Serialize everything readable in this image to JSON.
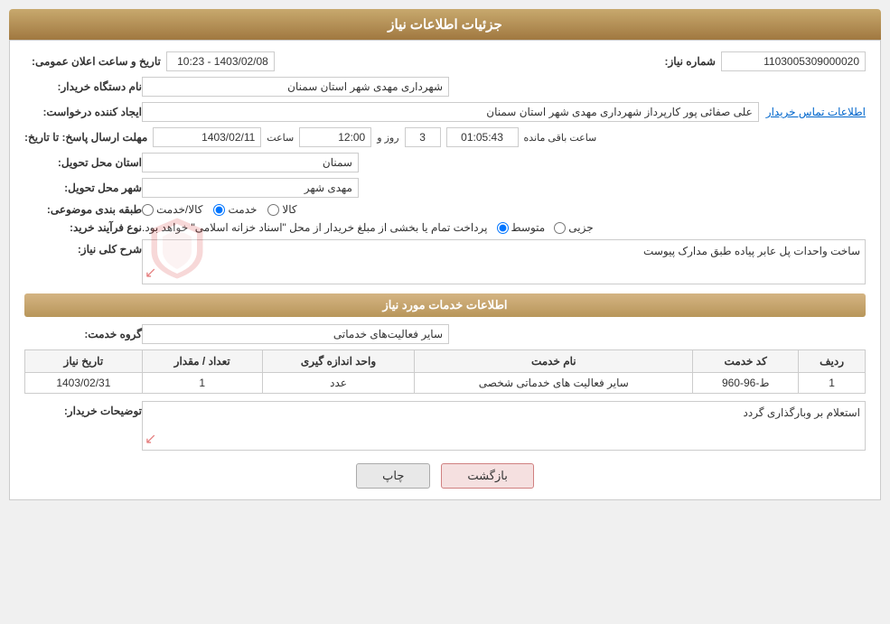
{
  "page": {
    "title": "جزئیات اطلاعات نیاز",
    "sections": {
      "basic_info": {
        "need_number_label": "شماره نیاز:",
        "need_number_value": "1103005309000020",
        "buyer_org_label": "نام دستگاه خریدار:",
        "buyer_org_value": "شهرداری مهدی شهر استان سمنان",
        "announce_date_label": "تاریخ و ساعت اعلان عمومی:",
        "announce_date_value": "1403/02/08 - 10:23",
        "creator_label": "ایجاد کننده درخواست:",
        "creator_value": "علی صفائی پور کارپرداز شهرداری مهدی شهر استان سمنان",
        "contact_link": "اطلاعات تماس خریدار",
        "deadline_label": "مهلت ارسال پاسخ: تا تاریخ:",
        "deadline_date": "1403/02/11",
        "deadline_time_label": "ساعت",
        "deadline_time": "12:00",
        "deadline_days_label": "روز و",
        "deadline_days": "3",
        "deadline_remaining_label": "ساعت باقی مانده",
        "deadline_remaining": "01:05:43",
        "province_label": "استان محل تحویل:",
        "province_value": "سمنان",
        "city_label": "شهر محل تحویل:",
        "city_value": "مهدی شهر",
        "category_label": "طبقه بندی موضوعی:",
        "category_options": [
          "کالا",
          "خدمت",
          "کالا/خدمت"
        ],
        "category_selected": "خدمت",
        "process_label": "نوع فرآیند خرید:",
        "process_options": [
          "جزیی",
          "متوسط"
        ],
        "process_text": "پرداخت تمام یا بخشی از مبلغ خریدار از محل \"اسناد خزانه اسلامی\" خواهد بود.",
        "process_selected": "متوسط"
      },
      "description": {
        "title": "شرح کلی نیاز:",
        "value": "ساخت واحدات پل عابر پیاده طبق مدارک پیوست"
      },
      "services": {
        "title": "اطلاعات خدمات مورد نیاز",
        "service_group_label": "گروه خدمت:",
        "service_group_value": "سایر فعالیت‌های خدماتی",
        "table": {
          "headers": [
            "ردیف",
            "کد خدمت",
            "نام خدمت",
            "واحد اندازه گیری",
            "تعداد / مقدار",
            "تاریخ نیاز"
          ],
          "rows": [
            {
              "row_num": "1",
              "service_code": "ط-96-960",
              "service_name": "سایر فعالیت های خدماتی شخصی",
              "unit": "عدد",
              "quantity": "1",
              "date": "1403/02/31"
            }
          ]
        }
      },
      "buyer_notes": {
        "label": "توضیحات خریدار:",
        "value": "استعلام بر وبارگذاری گردد"
      }
    },
    "buttons": {
      "print": "چاپ",
      "back": "بازگشت"
    }
  }
}
